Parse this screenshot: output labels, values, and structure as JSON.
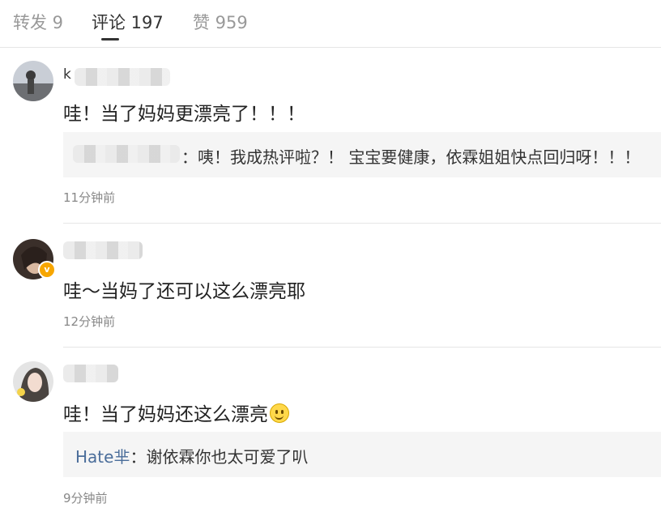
{
  "tabs": [
    {
      "label": "转发 9"
    },
    {
      "label": "评论 197"
    },
    {
      "label": "赞 959"
    }
  ],
  "comments": [
    {
      "username_visible": "k",
      "text": "哇！当了妈妈更漂亮了！！！",
      "reply": {
        "user": "",
        "text": "：咦！我成热评啦？！ 宝宝要健康，依霖姐姐快点回归呀！！！"
      },
      "time": "11分钟前"
    },
    {
      "username_visible": "",
      "verified_badge": "v",
      "text": "哇～当妈了还可以这么漂亮耶",
      "time": "12分钟前"
    },
    {
      "username_visible": "",
      "text": "哇！当了妈妈还这么漂亮",
      "emoji": "smile-emoji",
      "reply": {
        "user": "Hate芈",
        "text": "：谢依霖你也太可爱了叭"
      },
      "time": "9分钟前"
    }
  ],
  "colors": {
    "reply_user": "#4a6d9a",
    "badge": "#f7a600",
    "reply_bg": "#f5f5f5"
  }
}
